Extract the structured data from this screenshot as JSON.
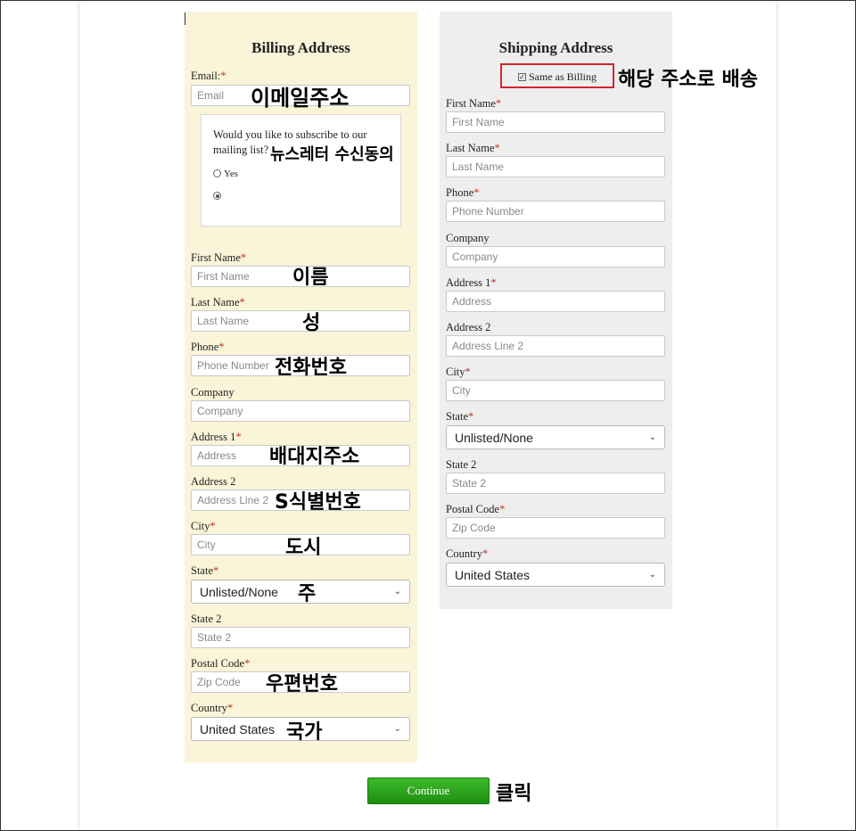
{
  "billing": {
    "title": "Billing Address",
    "email_label": "Email:",
    "email_placeholder": "Email",
    "subscribe_question": "Would you like to subscribe to our mailing list?",
    "subscribe_yes": "Yes",
    "first_name_label": "First Name",
    "first_name_placeholder": "First Name",
    "last_name_label": "Last Name",
    "last_name_placeholder": "Last Name",
    "phone_label": "Phone",
    "phone_placeholder": "Phone Number",
    "company_label": "Company",
    "company_placeholder": "Company",
    "address1_label": "Address 1",
    "address1_placeholder": "Address",
    "address2_label": "Address 2",
    "address2_placeholder": "Address Line 2",
    "city_label": "City",
    "city_placeholder": "City",
    "state_label": "State",
    "state_value": "Unlisted/None",
    "state2_label": "State 2",
    "state2_placeholder": "State 2",
    "postal_label": "Postal Code",
    "postal_placeholder": "Zip Code",
    "country_label": "Country",
    "country_value": "United States"
  },
  "shipping": {
    "title": "Shipping Address",
    "same_as_billing": "Same as Billing",
    "first_name_label": "First Name",
    "first_name_placeholder": "First Name",
    "last_name_label": "Last Name",
    "last_name_placeholder": "Last Name",
    "phone_label": "Phone",
    "phone_placeholder": "Phone Number",
    "company_label": "Company",
    "company_placeholder": "Company",
    "address1_label": "Address 1",
    "address1_placeholder": "Address",
    "address2_label": "Address 2",
    "address2_placeholder": "Address Line 2",
    "city_label": "City",
    "city_placeholder": "City",
    "state_label": "State",
    "state_value": "Unlisted/None",
    "state2_label": "State 2",
    "state2_placeholder": "State 2",
    "postal_label": "Postal Code",
    "postal_placeholder": "Zip Code",
    "country_label": "Country",
    "country_value": "United States"
  },
  "required_mark": "*",
  "continue_label": "Continue",
  "annotations": {
    "email": "이메일주소",
    "newsletter": "뉴스레터 수신동의",
    "first_name": "이름",
    "last_name": "성",
    "phone": "전화번호",
    "address1": "배대지주소",
    "address2": "S식별번호",
    "city": "도시",
    "state": "주",
    "postal": "우편번호",
    "country": "국가",
    "same_as_billing": "해당 주소로 배송",
    "continue": "클릭"
  },
  "colors": {
    "billing_bg": "#faf4d8",
    "shipping_bg": "#eeeeee",
    "required": "#c0392b",
    "highlight_border": "#d0272e",
    "continue_green": "#2aa31c"
  }
}
